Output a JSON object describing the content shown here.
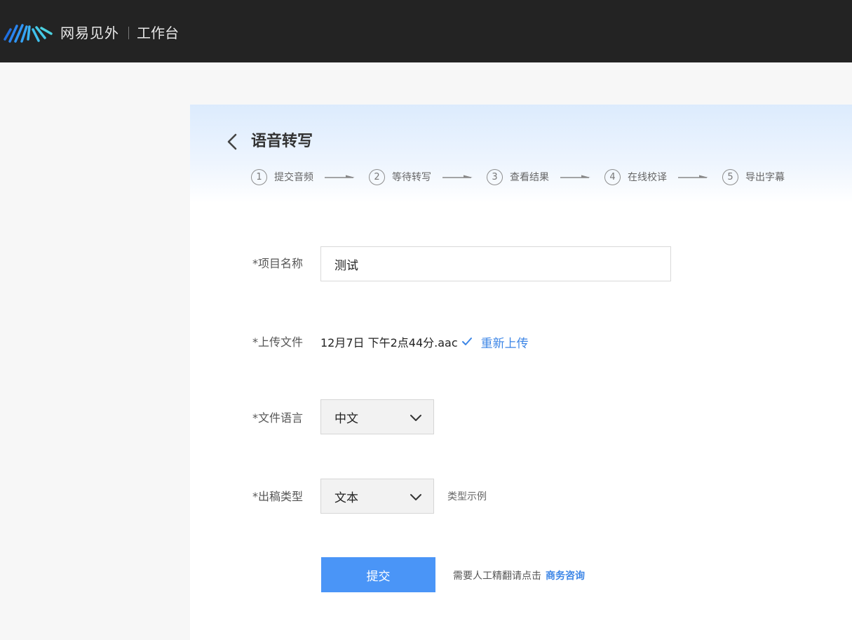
{
  "header": {
    "brand": "网易见外",
    "workspace": "工作台",
    "logo_icon": "waveform-logo-icon"
  },
  "page": {
    "title": "语音转写",
    "back_icon": "chevron-left-icon"
  },
  "steps": [
    {
      "num": "1",
      "label": "提交音频"
    },
    {
      "num": "2",
      "label": "等待转写"
    },
    {
      "num": "3",
      "label": "查看结果"
    },
    {
      "num": "4",
      "label": "在线校译"
    },
    {
      "num": "5",
      "label": "导出字幕"
    }
  ],
  "form": {
    "project_name": {
      "label": "*项目名称",
      "value": "测试"
    },
    "upload": {
      "label": "*上传文件",
      "file_name": "12月7日 下午2点44分.aac",
      "reupload": "重新上传"
    },
    "language": {
      "label": "*文件语言",
      "value": "中文"
    },
    "output_type": {
      "label": "*出稿类型",
      "value": "文本",
      "sample_link": "类型示例"
    },
    "submit": "提交",
    "hint": "需要人工精翻请点击",
    "consult": "商务咨询"
  },
  "colors": {
    "topbar": "#232323",
    "accent": "#4a95f7",
    "link": "#3d86e6"
  }
}
